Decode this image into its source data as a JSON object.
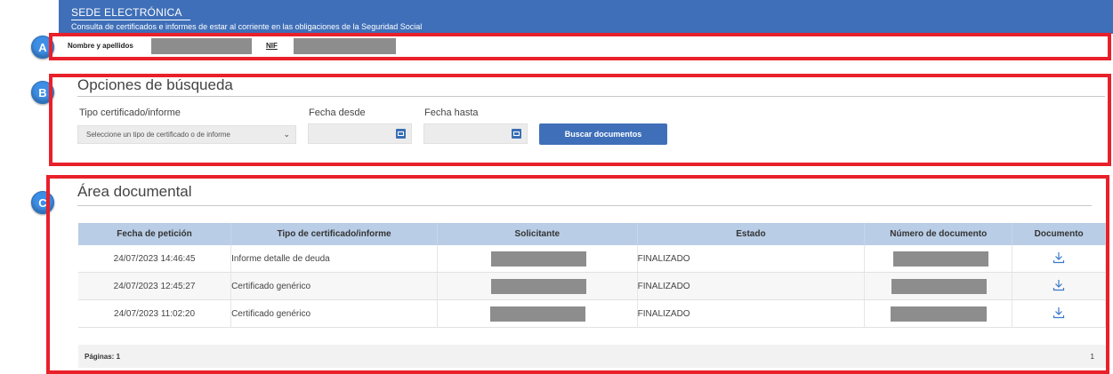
{
  "header": {
    "title": "SEDE ELECTRÓNICA",
    "subtitle": "Consulta de certificados e informes de estar al corriente en las obligaciones de la Seguridad Social"
  },
  "markers": [
    "A",
    "B",
    "C"
  ],
  "identity": {
    "nombre_label": "Nombre y apellidos",
    "nif_label": "NIF"
  },
  "search": {
    "title": "Opciones de búsqueda",
    "tipo_label": "Tipo certificado/informe",
    "tipo_placeholder": "Seleccione un tipo de certificado o de informe",
    "fecha_desde_label": "Fecha desde",
    "fecha_hasta_label": "Fecha hasta",
    "button_label": "Buscar documentos"
  },
  "documents": {
    "title": "Área documental",
    "columns": [
      "Fecha de petición",
      "Tipo de certificado/informe",
      "Solicitante",
      "Estado",
      "Número de documento",
      "Documento"
    ],
    "rows": [
      {
        "fecha": "24/07/2023 14:46:45",
        "tipo": "Informe detalle de deuda",
        "estado": "FINALIZADO"
      },
      {
        "fecha": "24/07/2023 12:45:27",
        "tipo": "Certificado genérico",
        "estado": "FINALIZADO"
      },
      {
        "fecha": "24/07/2023 11:02:20",
        "tipo": "Certificado genérico",
        "estado": "FINALIZADO"
      }
    ],
    "pagination": {
      "label": "Páginas: 1",
      "current": "1"
    }
  },
  "colors": {
    "header_bg": "#3f6fb8",
    "highlight_border": "#e8202a",
    "marker_bg": "#3d8ee6",
    "table_header_bg": "#b9cde6"
  }
}
